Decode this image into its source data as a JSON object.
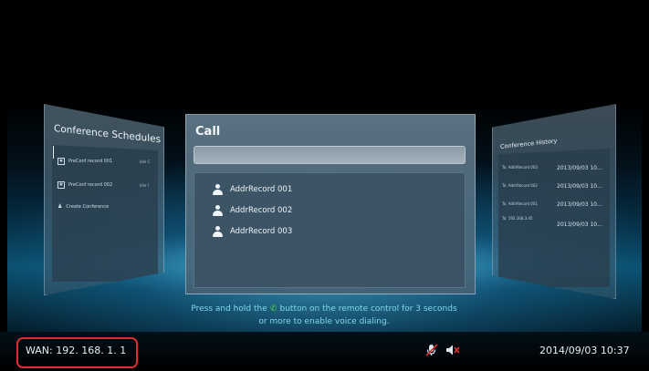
{
  "left_panel": {
    "title": "Conference Schedules",
    "items": [
      {
        "label": "PreConf record 001",
        "extra": "Idle C"
      },
      {
        "label": "PreConf record 002",
        "extra": "Idle I"
      },
      {
        "label": "Create Conference",
        "extra": ""
      }
    ]
  },
  "call_panel": {
    "title": "Call",
    "input_value": "",
    "contacts": [
      "AddrRecord 001",
      "AddrRecord 002",
      "AddrRecord 003"
    ]
  },
  "right_panel": {
    "title": "Conference History",
    "rows": [
      {
        "label": "To: AddrRecord 003",
        "date": "2013/09/03 10..."
      },
      {
        "label": "To: AddrRecord 002",
        "date": "2013/09/03 10..."
      },
      {
        "label": "To: AddrRecord 001",
        "date": "2013/09/03 10..."
      },
      {
        "label": "To: 192.168.3.45",
        "date": "2013/09/03 10..."
      }
    ]
  },
  "hint": {
    "before": "Press and hold the",
    "after": "button on the remote control for 3 seconds",
    "line2": "or more to enable voice dialing."
  },
  "status": {
    "wan": "WAN: 192. 168. 1. 1",
    "datetime": "2014/09/03 10:37",
    "mic_icon": "mic-muted-icon",
    "speaker_icon": "speaker-muted-icon"
  },
  "colors": {
    "highlight_border": "#d83030",
    "hint_text": "#7fd8ee",
    "phone_icon": "#4bd24b"
  }
}
